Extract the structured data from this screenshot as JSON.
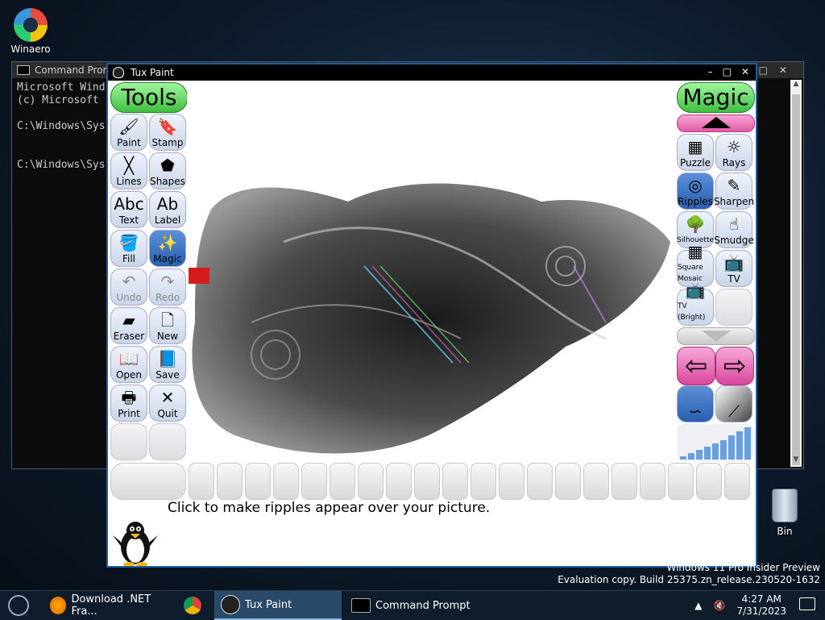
{
  "desktop": {
    "winaero_label": "Winaero",
    "bin_label": "Bin",
    "watermark_line1": "Windows 11 Pro Insider Preview",
    "watermark_line2": "Evaluation copy. Build 25375.zn_release.230520-1632"
  },
  "cmd": {
    "title": "Command Prompt",
    "lines": [
      "Microsoft Wind",
      "(c) Microsoft ",
      "",
      "C:\\Windows\\Sys",
      "",
      "",
      "C:\\Windows\\Sys"
    ]
  },
  "tuxpaint": {
    "title": "Tux Paint",
    "tools_header": "Tools",
    "magic_header": "Magic",
    "tools": [
      {
        "label": "Paint",
        "icon": "brush-icon",
        "sym": "🖌"
      },
      {
        "label": "Stamp",
        "icon": "stamp-icon",
        "sym": "🔖"
      },
      {
        "label": "Lines",
        "icon": "lines-icon",
        "sym": "╳"
      },
      {
        "label": "Shapes",
        "icon": "pentagon-icon",
        "sym": "⬟"
      },
      {
        "label": "Text",
        "icon": "text-icon",
        "sym": "Abc"
      },
      {
        "label": "Label",
        "icon": "label-icon",
        "sym": "Ab"
      },
      {
        "label": "Fill",
        "icon": "bucket-icon",
        "sym": "🪣"
      },
      {
        "label": "Magic",
        "icon": "magic-wand-icon",
        "sym": "✨"
      },
      {
        "label": "Undo",
        "icon": "undo-icon",
        "sym": "↶"
      },
      {
        "label": "Redo",
        "icon": "redo-icon",
        "sym": "↷"
      },
      {
        "label": "Eraser",
        "icon": "eraser-icon",
        "sym": "▰"
      },
      {
        "label": "New",
        "icon": "new-page-icon",
        "sym": "🗋"
      },
      {
        "label": "Open",
        "icon": "open-book-icon",
        "sym": "📖"
      },
      {
        "label": "Save",
        "icon": "save-book-icon",
        "sym": "📘"
      },
      {
        "label": "Print",
        "icon": "printer-icon",
        "sym": "🖶"
      },
      {
        "label": "Quit",
        "icon": "quit-icon",
        "sym": "✕"
      }
    ],
    "magic": [
      {
        "label": "Puzzle",
        "icon": "puzzle-icon",
        "sym": "▦"
      },
      {
        "label": "Rays",
        "icon": "rays-icon",
        "sym": "☼"
      },
      {
        "label": "Ripples",
        "icon": "ripples-icon",
        "sym": "◎"
      },
      {
        "label": "Sharpen",
        "icon": "sharpen-icon",
        "sym": "✎"
      },
      {
        "label": "Silhouette",
        "icon": "tree-icon",
        "sym": "🌳"
      },
      {
        "label": "Smudge",
        "icon": "smudge-icon",
        "sym": "☝"
      },
      {
        "label": "Square Mosaic",
        "icon": "mosaic-icon",
        "sym": "▦"
      },
      {
        "label": "TV",
        "icon": "tv-icon",
        "sym": "📺"
      },
      {
        "label": "TV (Bright)",
        "icon": "tv-bright-icon",
        "sym": "📺"
      }
    ],
    "status_text": "Click to make ripples appear over your picture."
  },
  "taskbar": {
    "items": [
      {
        "label": "Download .NET Fra...",
        "icon": "firefox-icon",
        "color": "#e66000"
      },
      {
        "label": "",
        "icon": "chrome-icon",
        "color": "#4285f4"
      },
      {
        "label": "Tux Paint",
        "icon": "tuxpaint-icon",
        "color": "#222222"
      },
      {
        "label": "Command Prompt",
        "icon": "cmd-icon",
        "color": "#000000"
      }
    ],
    "time": "4:27 AM",
    "date": "7/31/2023"
  }
}
